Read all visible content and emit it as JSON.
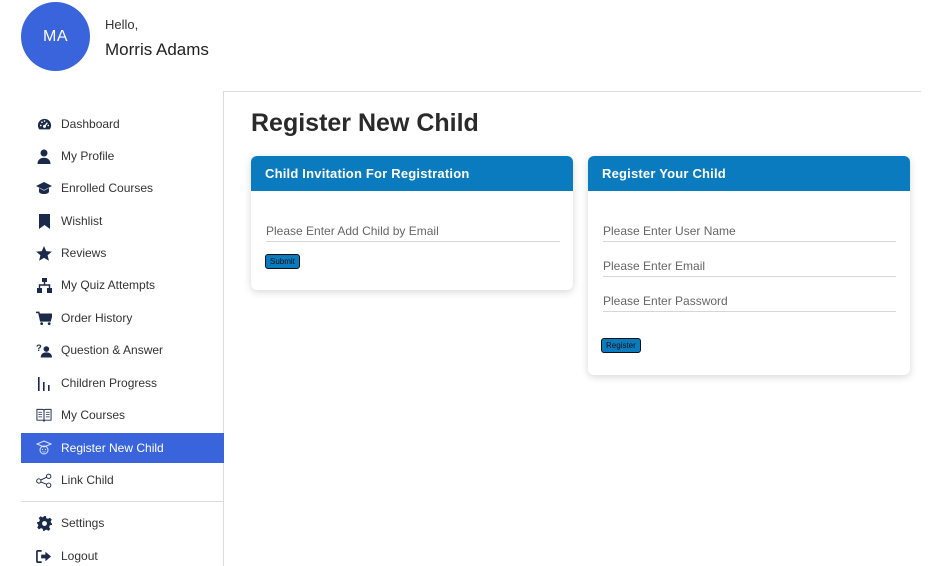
{
  "user": {
    "initials": "MA",
    "greeting": "Hello,",
    "name": "Morris Adams"
  },
  "sidebar": {
    "items": [
      {
        "label": "Dashboard",
        "icon": "dashboard-icon"
      },
      {
        "label": "My Profile",
        "icon": "user-icon"
      },
      {
        "label": "Enrolled Courses",
        "icon": "graduation-cap-icon"
      },
      {
        "label": "Wishlist",
        "icon": "bookmark-icon"
      },
      {
        "label": "Reviews",
        "icon": "star-icon"
      },
      {
        "label": "My Quiz Attempts",
        "icon": "sitemap-icon"
      },
      {
        "label": "Order History",
        "icon": "cart-icon"
      },
      {
        "label": "Question & Answer",
        "icon": "question-answer-icon"
      },
      {
        "label": "Children Progress",
        "icon": "bar-chart-icon"
      },
      {
        "label": "My Courses",
        "icon": "book-icon"
      },
      {
        "label": "Register New Child",
        "icon": "child-register-icon",
        "active": true
      },
      {
        "label": "Link Child",
        "icon": "share-link-icon"
      }
    ],
    "bottom": [
      {
        "label": "Settings",
        "icon": "gear-icon"
      },
      {
        "label": "Logout",
        "icon": "logout-icon"
      }
    ]
  },
  "main": {
    "title": "Register New Child",
    "invite_card": {
      "title": "Child Invitation For Registration",
      "email_placeholder": "Please Enter Add Child by Email",
      "submit_label": "Submit"
    },
    "register_card": {
      "title": "Register Your Child",
      "username_placeholder": "Please Enter User Name",
      "email_placeholder": "Please Enter Email",
      "password_placeholder": "Please Enter Password",
      "register_label": "Register"
    }
  },
  "colors": {
    "accent": "#3a64dc",
    "card_header": "#0b7bbf",
    "icon": "#1b2a4a"
  }
}
